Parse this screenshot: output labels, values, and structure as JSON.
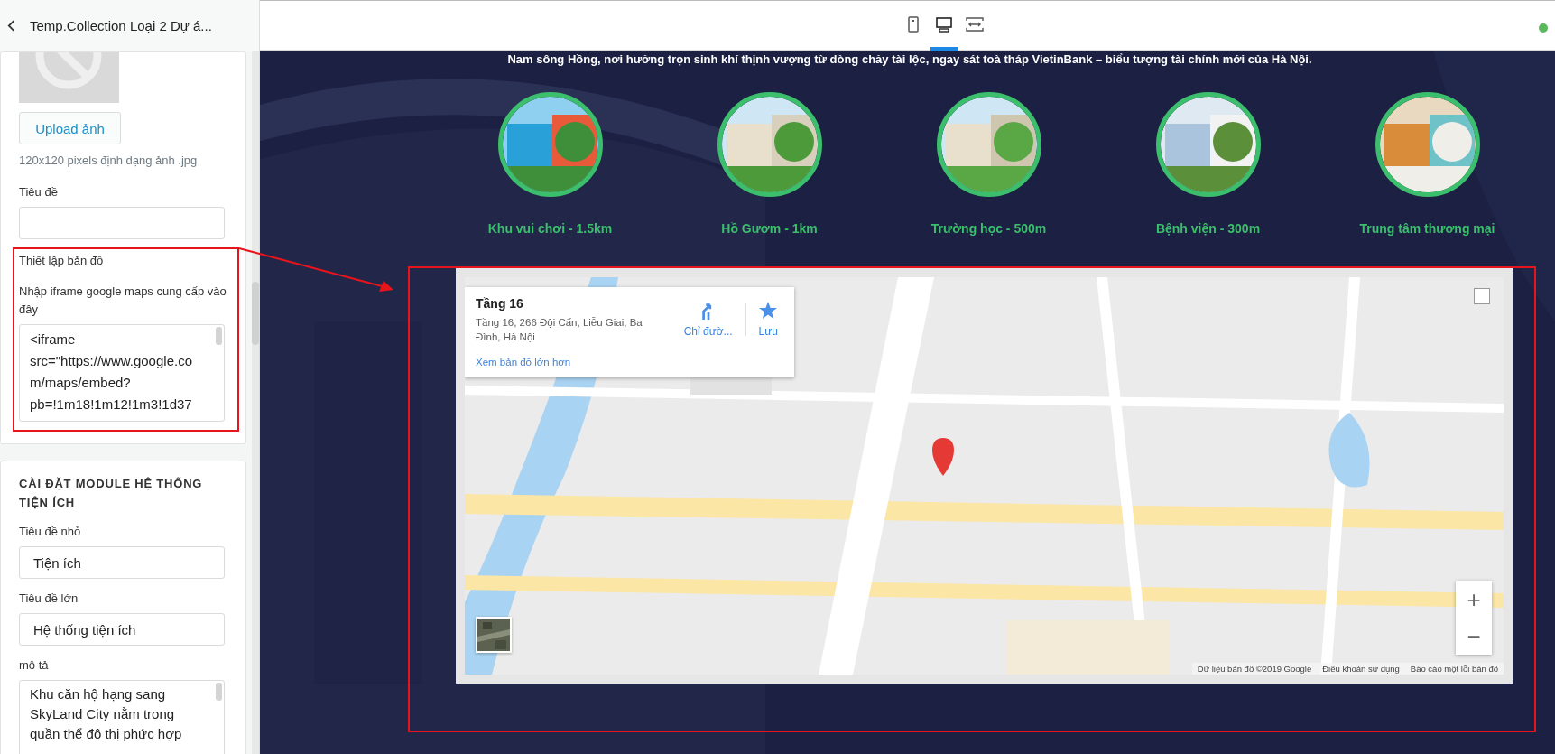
{
  "sidebar": {
    "title": "Temp.Collection Loại 2 Dự á...",
    "image_card": {
      "upload_button": "Upload ảnh",
      "hint": "120x120 pixels định dạng ảnh .jpg",
      "title_field": {
        "label": "Tiêu đề"
      },
      "map_setup": {
        "heading": "Thiết lập bản đồ",
        "label": "Nhập iframe google maps cung cấp vào đây",
        "value": "<iframe src=\"https://www.google.com/maps/embed?pb=!1m18!1m12!1m3!1d37"
      }
    },
    "module_card": {
      "heading": "CÀI ĐẶT MODULE HỆ THỐNG TIỆN ÍCH",
      "fields": [
        {
          "kind": "input",
          "label": "Tiêu đề nhỏ",
          "value": "Tiện ích"
        },
        {
          "kind": "input",
          "label": "Tiêu đề lớn",
          "value": "Hệ thống tiện ích"
        },
        {
          "kind": "textarea",
          "label": "mô tả",
          "value": "Khu căn hộ hạng sang SkyLand City nằm trong quần thể đô thị phức hợp"
        }
      ]
    }
  },
  "topbar": {
    "view_tabs": [
      {
        "kind": "mobile",
        "selected": false
      },
      {
        "kind": "desktop",
        "selected": true
      },
      {
        "kind": "fullwidth",
        "selected": false
      }
    ]
  },
  "preview": {
    "intro": "Nam sông Hồng, nơi hưởng trọn sinh khí thịnh vượng từ dòng chảy tài lộc, ngay sát toà tháp VietinBank – biểu tượng tài chính mới của Hà Nội.",
    "amenities": [
      {
        "label": "Khu vui chơi - 1.5km",
        "kind": "picture"
      },
      {
        "label": "Hồ Gươm - 1km",
        "kind": "picture"
      },
      {
        "label": "Trường học - 500m",
        "kind": "picture"
      },
      {
        "label": "Bệnh viện - 300m",
        "kind": "picture"
      },
      {
        "label": "Trung tâm thương mại",
        "kind": "picture"
      }
    ],
    "map": {
      "place_title": "Tầng 16",
      "address": "Tầng 16, 266 Đội Cấn, Liễu Giai, Ba Đình, Hà Nội",
      "directions": "Chỉ đườ...",
      "save": "Lưu",
      "larger_map_link": "Xem bản đồ lớn hơn",
      "zoom_in": "+",
      "zoom_out": "−",
      "attributions": [
        "Dữ liệu bản đồ ©2019 Google",
        "Điều khoản sử dụng",
        "Báo cáo một lỗi bản đồ"
      ]
    }
  }
}
